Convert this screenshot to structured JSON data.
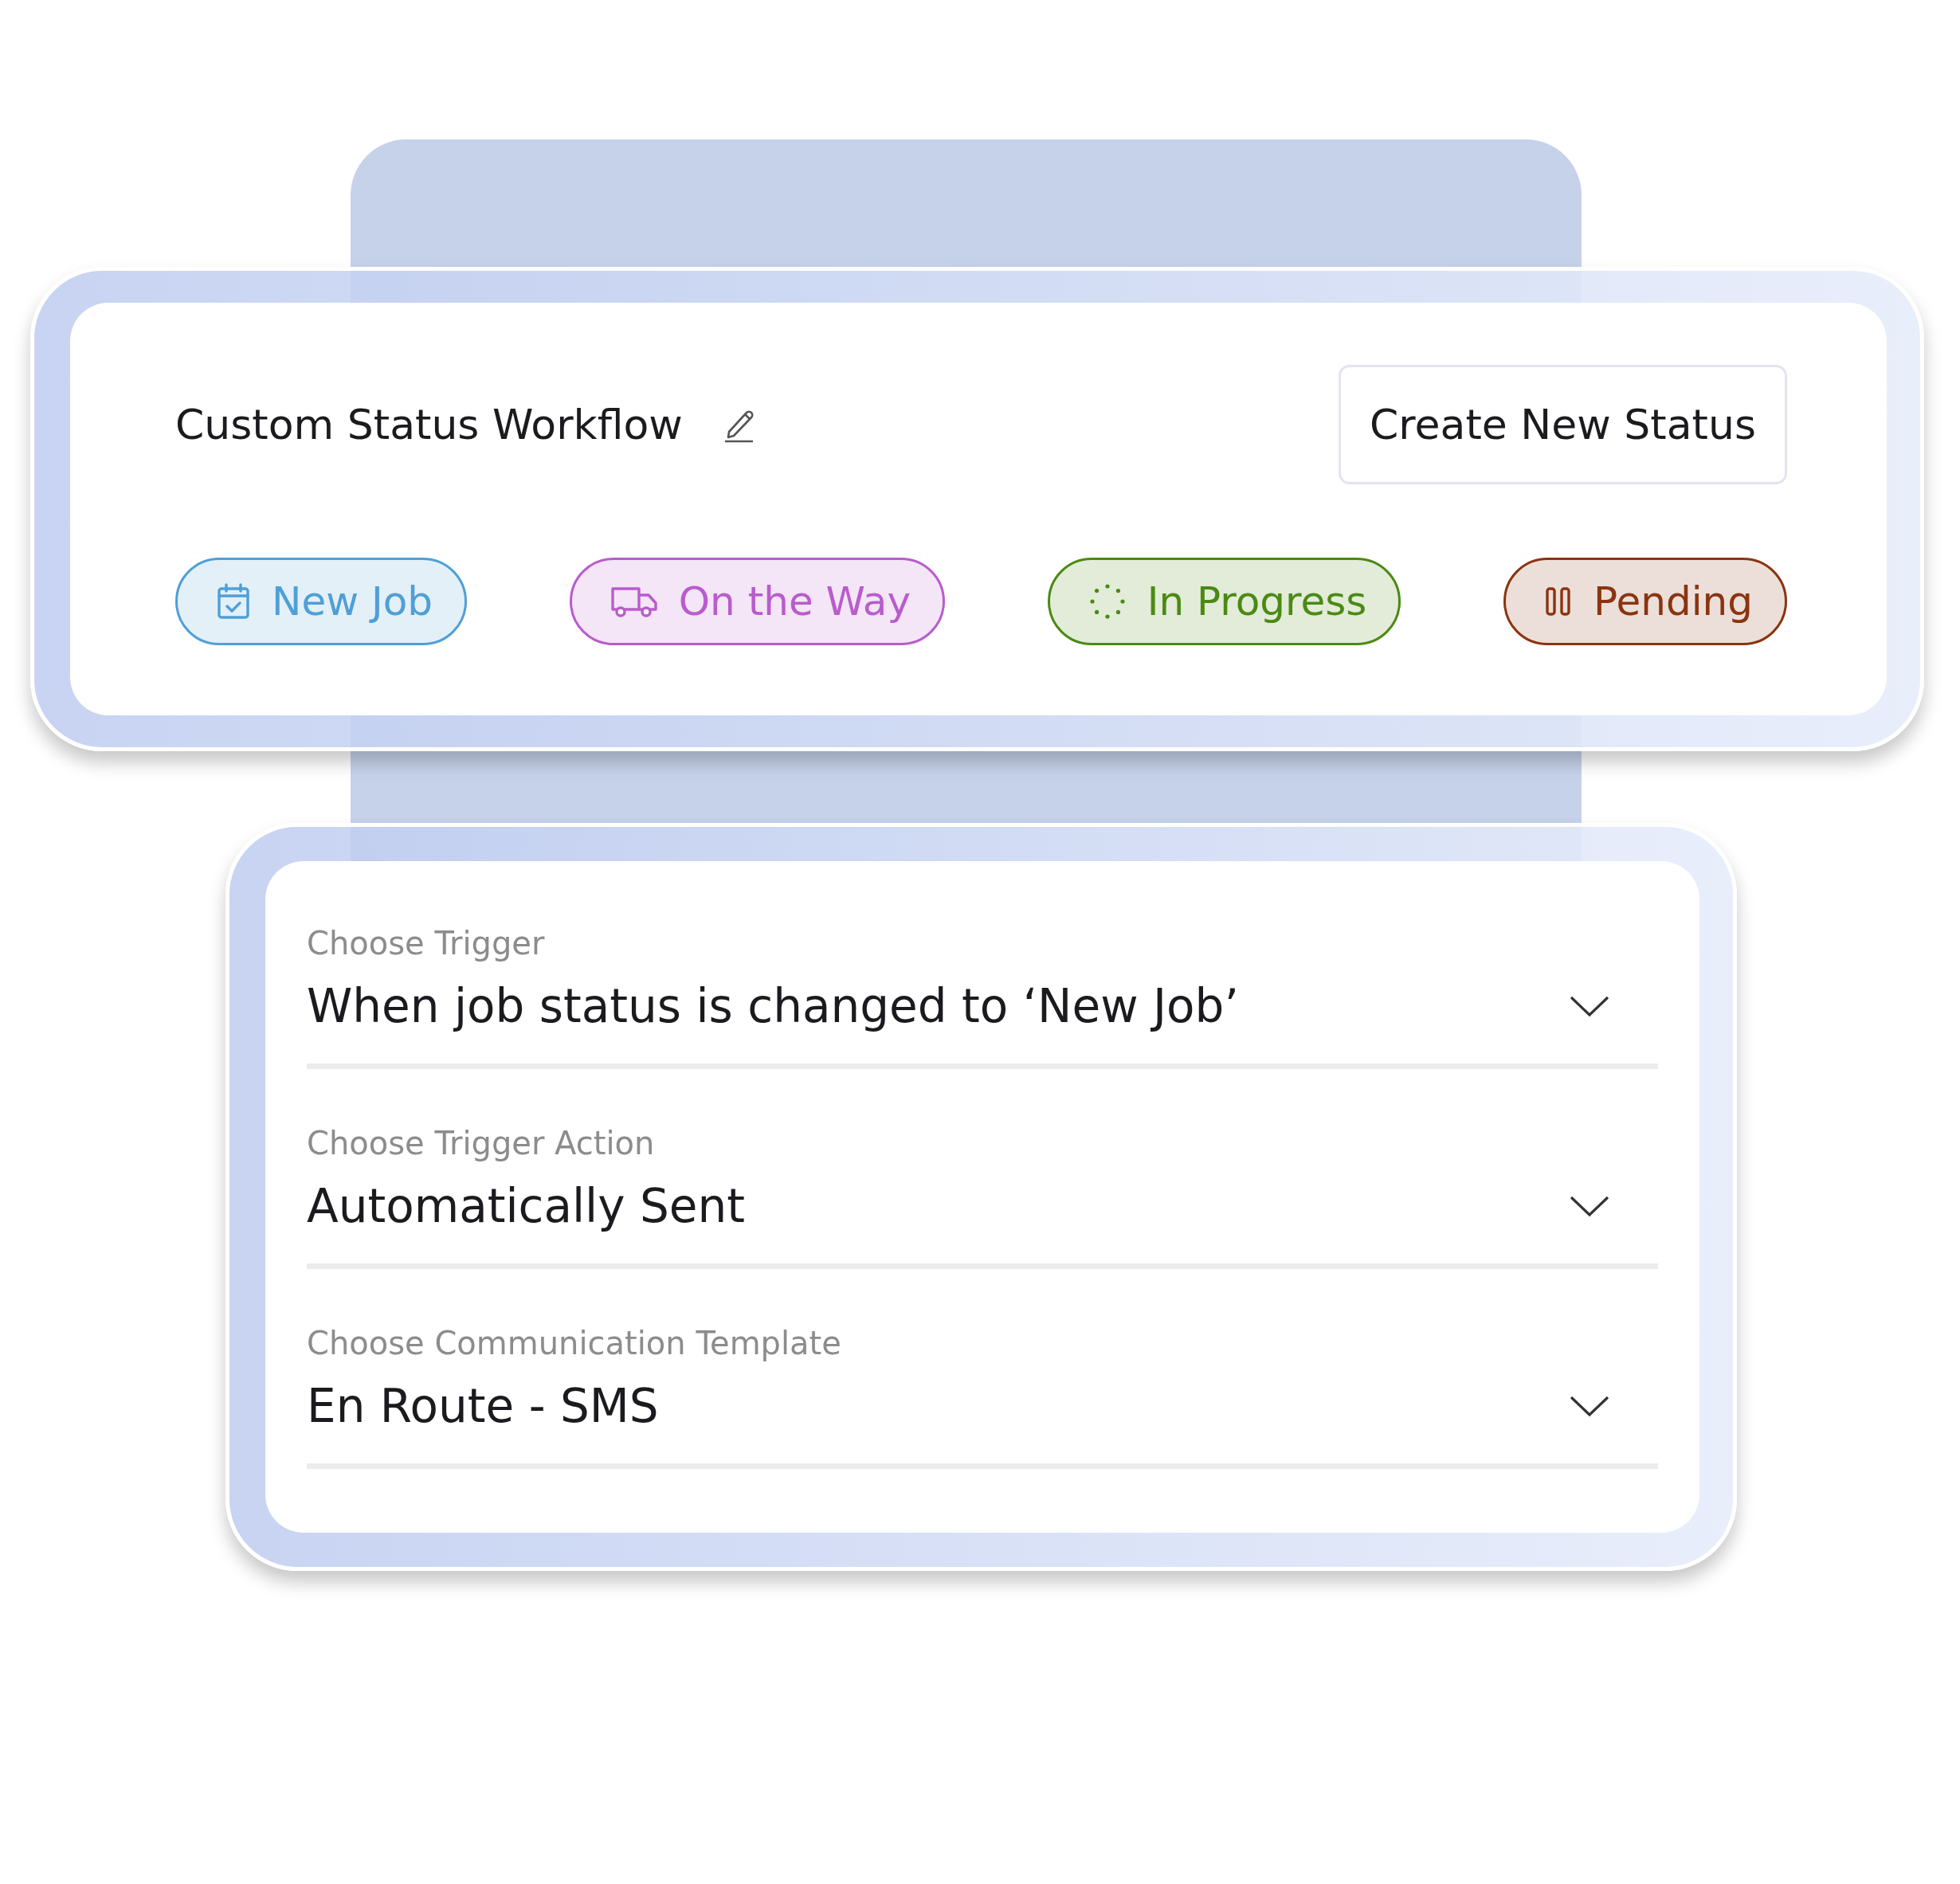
{
  "header": {
    "title": "Custom Status Workflow",
    "create_button": "Create New Status"
  },
  "statuses": [
    {
      "label": "New Job",
      "kind": "calendar",
      "color": "#4f9fd6"
    },
    {
      "label": "On the Way",
      "kind": "truck",
      "color": "#b95ccc"
    },
    {
      "label": "In Progress",
      "kind": "spinner",
      "color": "#4b8a12"
    },
    {
      "label": "Pending",
      "kind": "pause",
      "color": "#8a3410"
    }
  ],
  "fields": [
    {
      "label": "Choose Trigger",
      "value": "When job status is changed to ‘New Job’"
    },
    {
      "label": "Choose Trigger Action",
      "value": "Automatically Sent"
    },
    {
      "label": "Choose Communication Template",
      "value": "En Route - SMS"
    }
  ]
}
